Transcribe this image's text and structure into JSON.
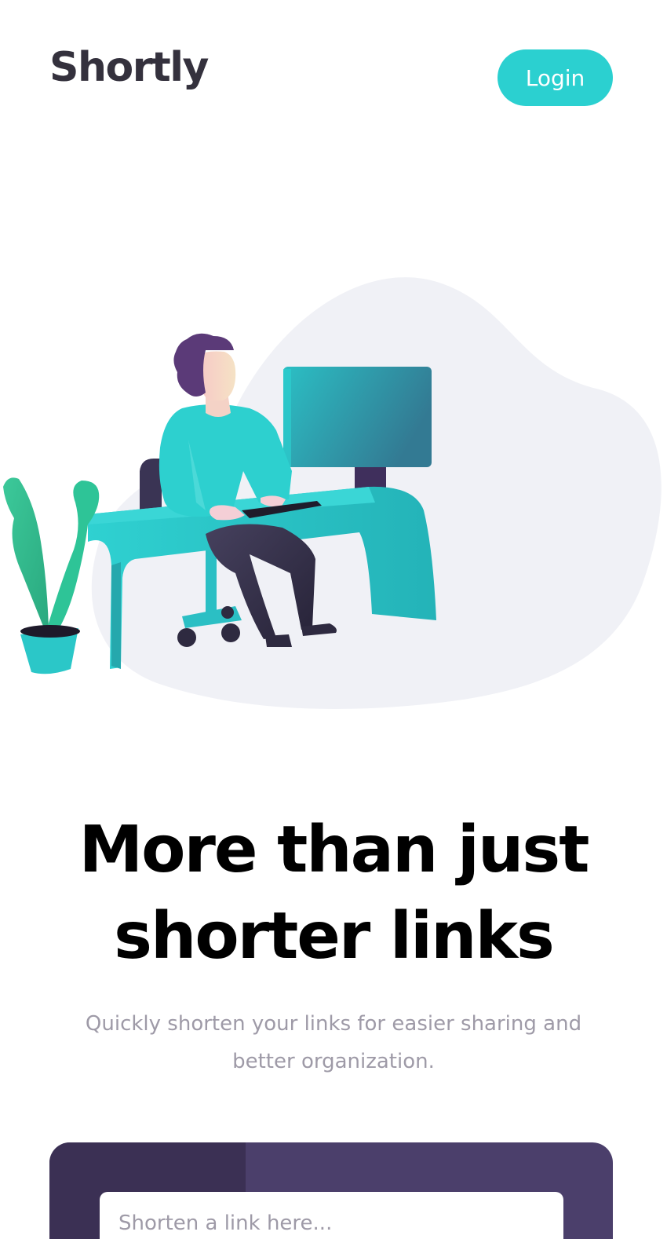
{
  "header": {
    "logo": "Shortly",
    "login_label": "Login"
  },
  "hero": {
    "illustration": "person-working-at-desk-illustration",
    "headline_line1": "More than just",
    "headline_line2": "shorter links",
    "subtext": "Quickly shorten your links for easier sharing and better organization."
  },
  "shorten": {
    "placeholder": "Shorten a link here..."
  },
  "colors": {
    "accent": "#2bd0d0",
    "dark_violet": "#3b3054",
    "violet": "#4b3f6b",
    "text_dark": "#34313d",
    "text_gray": "#9e9aa7",
    "blob": "#f0f1f6"
  }
}
